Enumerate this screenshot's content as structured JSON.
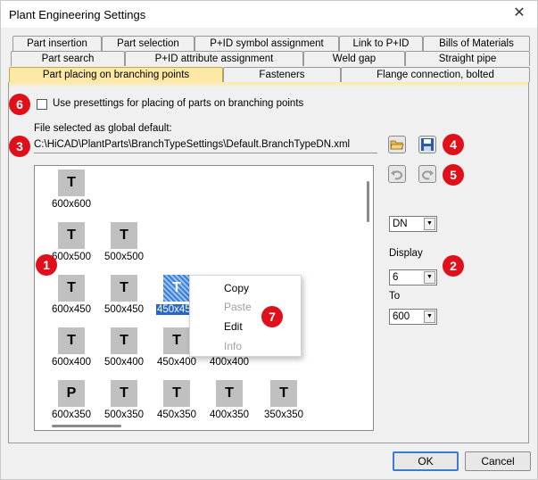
{
  "window": {
    "title": "Plant Engineering Settings",
    "close_glyph": "✕"
  },
  "tabs": {
    "row1": [
      "Part insertion",
      "Part selection",
      "P+ID symbol assignment",
      "Link to P+ID",
      "Bills of Materials"
    ],
    "row2": [
      "Part search",
      "P+ID attribute assignment",
      "Weld gap",
      "Straight pipe"
    ],
    "row3": [
      "Part placing on branching points",
      "Fasteners",
      "Flange connection, bolted"
    ],
    "active": "Part placing on branching points"
  },
  "options": {
    "use_presettings_label": "Use presettings for placing of parts on branching points",
    "use_presettings_checked": false,
    "global_default_label": "File selected as global default:",
    "global_default_path": "C:\\HiCAD\\PlantParts\\BranchTypeSettings\\Default.BranchTypeDN.xml"
  },
  "icons": {
    "open": "folder-open-icon",
    "save": "save-disk-icon",
    "undo": "undo-icon",
    "redo": "redo-icon"
  },
  "grid": {
    "rows": [
      [
        {
          "symbol": "T",
          "label": "600x600"
        }
      ],
      [
        {
          "symbol": "T",
          "label": "600x500"
        },
        {
          "symbol": "T",
          "label": "500x500"
        }
      ],
      [
        {
          "symbol": "T",
          "label": "600x450"
        },
        {
          "symbol": "T",
          "label": "500x450"
        },
        {
          "symbol": "T",
          "label": "450x450",
          "selected": true
        }
      ],
      [
        {
          "symbol": "T",
          "label": "600x400"
        },
        {
          "symbol": "T",
          "label": "500x400"
        },
        {
          "symbol": "T",
          "label": "450x400"
        },
        {
          "symbol": "",
          "label": "400x400"
        }
      ],
      [
        {
          "symbol": "P",
          "label": "600x350"
        },
        {
          "symbol": "T",
          "label": "500x350"
        },
        {
          "symbol": "T",
          "label": "450x350"
        },
        {
          "symbol": "T",
          "label": "400x350"
        },
        {
          "symbol": "T",
          "label": "350x350"
        }
      ]
    ]
  },
  "right": {
    "unit_select": "DN",
    "display_label": "Display",
    "display_select": "6",
    "to_label": "To",
    "to_select": "600"
  },
  "context_menu": [
    {
      "label": "Copy",
      "enabled": true
    },
    {
      "label": "Paste",
      "enabled": false
    },
    {
      "label": "Edit",
      "enabled": true
    },
    {
      "label": "Info",
      "enabled": false
    }
  ],
  "callouts": [
    "1",
    "2",
    "3",
    "4",
    "5",
    "6",
    "7"
  ],
  "buttons": {
    "ok": "OK",
    "cancel": "Cancel"
  },
  "colors": {
    "active_tab": "#fde8a6",
    "callout": "#e0101a",
    "selection": "#2a66c8"
  }
}
